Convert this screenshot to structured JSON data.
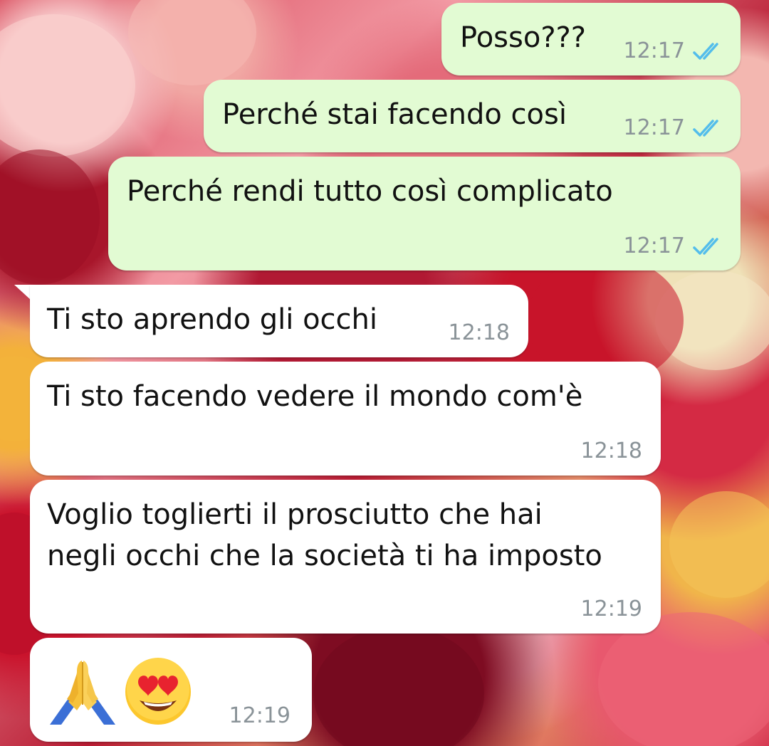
{
  "chat": {
    "messages": [
      {
        "direction": "outgoing",
        "text": "Posso???",
        "time": "12:17",
        "status": "read"
      },
      {
        "direction": "outgoing",
        "text": "Perché stai facendo così",
        "time": "12:17",
        "status": "read"
      },
      {
        "direction": "outgoing",
        "text": "Perché rendi tutto così complicato",
        "time": "12:17",
        "status": "read"
      },
      {
        "direction": "incoming",
        "text": "Ti sto aprendo gli occhi",
        "time": "12:18"
      },
      {
        "direction": "incoming",
        "text": "Ti sto facendo vedere il mondo com'è",
        "time": "12:18"
      },
      {
        "direction": "incoming",
        "text_lines": [
          "Voglio toglierti il prosciutto che hai",
          "negli occhi che la società ti ha imposto"
        ],
        "time": "12:19"
      },
      {
        "direction": "incoming",
        "emojis": [
          "folded-hands-emoji",
          "smiling-face-with-heart-eyes-emoji"
        ],
        "time": "12:19"
      }
    ]
  },
  "colors": {
    "outgoing_bubble": "#e2fbd3",
    "incoming_bubble": "#ffffff",
    "read_ticks": "#53bdeb",
    "timestamp": "#8a9398"
  }
}
